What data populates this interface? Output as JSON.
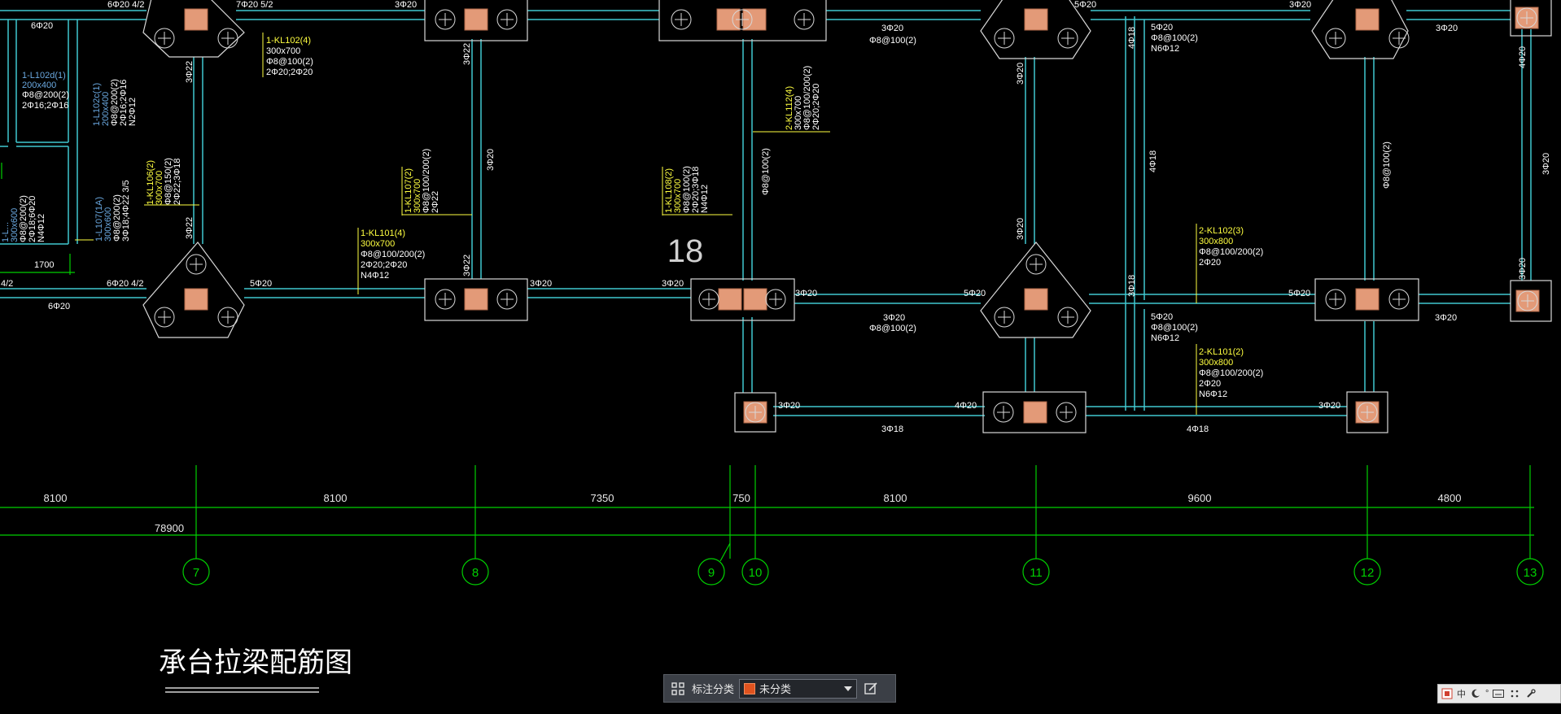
{
  "drawing": {
    "title": "承台拉梁配筋图",
    "center_label": "18",
    "axis_labels": [
      "7",
      "8",
      "9",
      "10",
      "11",
      "12",
      "13"
    ],
    "dimensions": [
      "8100",
      "8100",
      "7350",
      "750",
      "8100",
      "9600",
      "4800"
    ],
    "total_dimension": "78900",
    "beam_texts": {
      "kl102_4": [
        "1-KL102(4)",
        "300x700",
        "Φ8@100(2)",
        "2Φ20;2Φ20"
      ],
      "kl101_4": [
        "1-KL101(4)",
        "300x700",
        "Φ8@100/200(2)",
        "2Φ20;2Φ20",
        "N4Φ12"
      ],
      "kl107_2": [
        "1-KL107(2)",
        "300x700",
        "Φ8@100/200(2)",
        "2Φ22"
      ],
      "kl108_2": [
        "1-KL108(2)",
        "300x700",
        "Φ8@100(2)",
        "2Φ20;3Φ18",
        "N4Φ12"
      ],
      "kl106_2": [
        "1-KL106(2)",
        "300x700",
        "Φ8@150(2)",
        "2Φ22;3Φ18"
      ],
      "l102d_1": [
        "1-L102d(1)",
        "200x400",
        "Φ8@200(2)",
        "2Φ16;2Φ16"
      ],
      "l102c_1": [
        "1-L102c(1)",
        "200x400",
        "Φ8@200(2)",
        "2Φ16;2Φ16",
        "N2Φ12"
      ],
      "l107_1a": [
        "1-L107(1A)",
        "300x600",
        "Φ8@200(2)",
        "3Φ18;4Φ22 3/5"
      ],
      "l_left": [
        "1-L...",
        "300x600",
        "Φ8@200(2)",
        "2Φ18;6Φ20",
        "N4Φ12"
      ],
      "kl112_4": [
        "2-KL112(4)",
        "300x700",
        "Φ8@100/200(2)",
        "2Φ20;2Φ20"
      ],
      "kl102_3": [
        "2-KL102(3)",
        "300x800",
        "Φ8@100/200(2)",
        "2Φ20"
      ],
      "kl101_2": [
        "2-KL101(2)",
        "300x800",
        "Φ8@100/200(2)",
        "2Φ20",
        "N6Φ12"
      ]
    },
    "rebar_texts": {
      "t_6_20_4_2_top": "6Φ20 4/2",
      "t_7_20_5_2": "7Φ20 5/2",
      "t_3_20_top1": "3Φ20",
      "t_6_20_left": "6Φ20",
      "t_3_22_a": "3Φ22",
      "t_3_22_b": "3Φ22",
      "t_3_22_c": "3Φ22",
      "t_3_22_d": "3Φ22",
      "t_3_20_v": "3Φ20",
      "t_8_100_v": "Φ8@100(2)",
      "t_3_20_r1": "3Φ20",
      "t_8_100_r1": "Φ8@100(2)",
      "t_5_20_top": "5Φ20",
      "t_3_20_v2": "3Φ20",
      "t_3_20_v3": "3Φ20",
      "t_4_18_v": "4Φ18",
      "t_4_18_v2": "4Φ18",
      "t_5_20_r": "5Φ20",
      "t_8_100_r": "Φ8@100(2)",
      "t_n6_12_r": "N6Φ12",
      "t_8_100_v2": "Φ8@100(2)",
      "t_3_20_top2": "3Φ20",
      "t_3_20_top3": "3Φ20",
      "t_4_20_v": "4Φ20",
      "t_3_20_v4": "3Φ20",
      "t_3_20_v5": "3Φ20",
      "t_6_20_4_2_mid": "6Φ20 4/2",
      "t_5_20_mid1": "5Φ20",
      "t_3_20_mid1": "3Φ20",
      "t_3_20_mid2": "3Φ20",
      "t_3_20_mid3": "3Φ20",
      "t_5_20_mid2": "5Φ20",
      "t_3_20_mid4": "3Φ20",
      "t_8_100_mid": "Φ8@100(2)",
      "t_5_20_mid3": "5Φ20",
      "t_3_20_mid5": "3Φ20",
      "t_5_20_r2": "5Φ20",
      "t_8_100_r2": "Φ8@100(2)",
      "t_n6_12_r2": "N6Φ12",
      "t_6_20_bot": "6Φ20",
      "t_3_18_v": "3Φ18",
      "t_1700": "1700",
      "t_4_2_left": "4/2",
      "t_3_20_low1": "3Φ20",
      "t_4_20_low": "4Φ20",
      "t_3_18_low": "3Φ18",
      "t_3_20_low2": "3Φ20",
      "t_4_18_low": "4Φ18"
    }
  },
  "toolbar": {
    "label": "标注分类",
    "selected": "未分类",
    "swatch_color": "#e0531f"
  },
  "tray": {
    "items": [
      "中",
      "°",
      "⚙"
    ]
  },
  "colors": {
    "beam": "#40c8d0",
    "axis": "#00d000",
    "annotation": "#ffff40",
    "secondary": "#6aa8e0",
    "text": "#ffffff",
    "pile": "#e39a78"
  }
}
